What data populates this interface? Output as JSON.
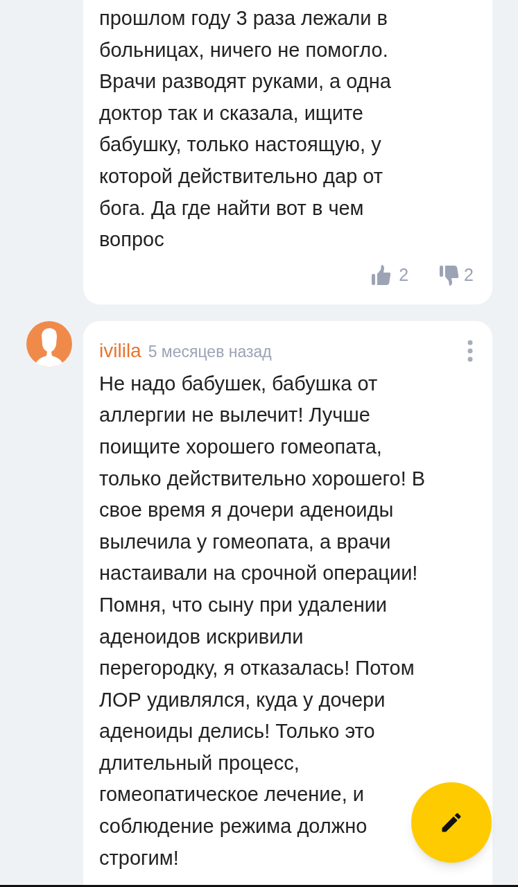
{
  "comments": [
    {
      "body": "прошлом году 3 раза лежали в\nбольницах, ничего не помогло.\nВрачи разводят руками, а одна\nдоктор так и сказала, ищите\nбабушку, только настоящую, у\nкоторой действительно дар от\nбога. Да где найти вот в чем\nвопрос",
      "likes": "2",
      "dislikes": "2"
    },
    {
      "author": "ivilila",
      "time": "5 месяцев назад",
      "body": "Не надо бабушек, бабушка от\nаллергии не вылечит! Лучше\nпоищите хорошего гомеопата,\nтолько действительно хорошего! В\nсвое время я дочери аденоиды\nвылечила у гомеопата, а врачи\nнастаивали на срочной операции!\nПомня, что сыну при удалении\nаденоидов искривили\nперегородку, я отказалась! Потом\nЛОР удивлялся, куда у дочери\nаденоиды делись! Только это\nдлительный процесс,\nгомеопатическое лечение, и\nсоблюдение режима должно\nстрогим!"
    }
  ]
}
